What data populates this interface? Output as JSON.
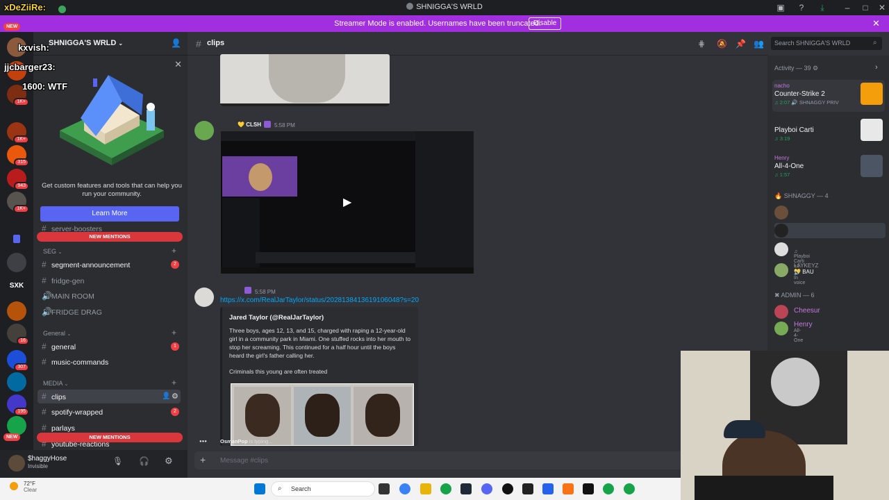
{
  "window": {
    "title": "SHNIGGA'S WRLD"
  },
  "banner": {
    "message": "Streamer Mode is enabled. Usernames have been truncated.",
    "disable_label": "Disable"
  },
  "overlay_chat": [
    {
      "user": "xDeZiiRe:",
      "text": ""
    },
    {
      "user": "kxvish:",
      "text": ""
    },
    {
      "user": "jjcbarger23:",
      "text": ""
    },
    {
      "user": "1600:",
      "text": "WTF"
    }
  ],
  "rail": {
    "new_label": "NEW",
    "badges": [
      "1K+",
      "1K+",
      "315",
      "943",
      "1K+",
      "16",
      "307",
      "195"
    ]
  },
  "server": {
    "name": "SHNIGGA'S WRLD"
  },
  "boost": {
    "description": "Get custom features and tools that can help you run your community.",
    "button": "Learn More"
  },
  "channels": {
    "new_mentions": "NEW MENTIONS",
    "cut_top": "server-boosters",
    "seg_category": "SEG",
    "general_category": "General",
    "media_category": "MEDIA",
    "seg": [
      {
        "name": "segment-announcement",
        "count": "2"
      },
      {
        "name": "fridge-gen"
      },
      {
        "name": "MAIN ROOM"
      },
      {
        "name": "FRIDGE DRAG"
      }
    ],
    "general": [
      {
        "name": "general",
        "count": "1"
      },
      {
        "name": "music-commands"
      }
    ],
    "media": [
      {
        "name": "clips"
      },
      {
        "name": "spotify-wrapped",
        "count": "2"
      },
      {
        "name": "parlays"
      }
    ],
    "cut_bottom": "youtube-reactions"
  },
  "user": {
    "name": "$haggyHose",
    "status": "Invisible"
  },
  "chat": {
    "channel": "clips",
    "msg1": {
      "author": "CLSH",
      "time": "5:58 PM"
    },
    "msg2": {
      "time": "5:58 PM",
      "link": "https://x.com/RealJarTaylor/status/2028138413619106048?s=20"
    },
    "embed": {
      "author": "Jared Taylor (@RealJarTaylor)",
      "body": "Three boys, ages 12, 13, and 15, charged with raping a 12-year-old girl in a community park in Miami. One stuffed rocks into her mouth to stop her screaming. This continued for a half hour until the boys heard the girl's father calling her.",
      "body2": "Criminals this young are often treated"
    },
    "typing_user": "OsmanPop",
    "typing_text": "is typing...",
    "placeholder": "Message #clips"
  },
  "search": {
    "placeholder": "Search SHNIGGA'S WRLD"
  },
  "members": {
    "activity_header": "Activity — 39",
    "activities": [
      {
        "user": "nacho",
        "title": "Counter-Strike 2",
        "time": "2:07",
        "extra": "SHNAGGY PRIV"
      },
      {
        "user": "",
        "title": "Playboi Carti",
        "time": "3:19",
        "extra": ""
      },
      {
        "user": "Henry",
        "title": "All-4-One",
        "time": "1:57",
        "extra": ""
      }
    ],
    "shnaggy_header": "SHNAGGY — 4",
    "shnaggy": [
      {
        "name": "",
        "status": ""
      },
      {
        "name": "",
        "status": ""
      },
      {
        "name": "",
        "status": "Playboi Carti +1"
      },
      {
        "name": "LAYKEYZ",
        "status": "In voice",
        "tag": "BAU"
      }
    ],
    "admin_header": "ADMIN — 6",
    "admin": [
      {
        "name": "Cheesur",
        "status": ""
      },
      {
        "name": "Henry",
        "status": "All-4-One"
      }
    ]
  },
  "taskbar": {
    "temp": "72°F",
    "weather": "Clear",
    "search": "Search"
  },
  "colors": {
    "blurple": "#5865f2",
    "streamer": "#a12fe0",
    "mention_red": "#da373c",
    "link": "#00a8fc"
  }
}
